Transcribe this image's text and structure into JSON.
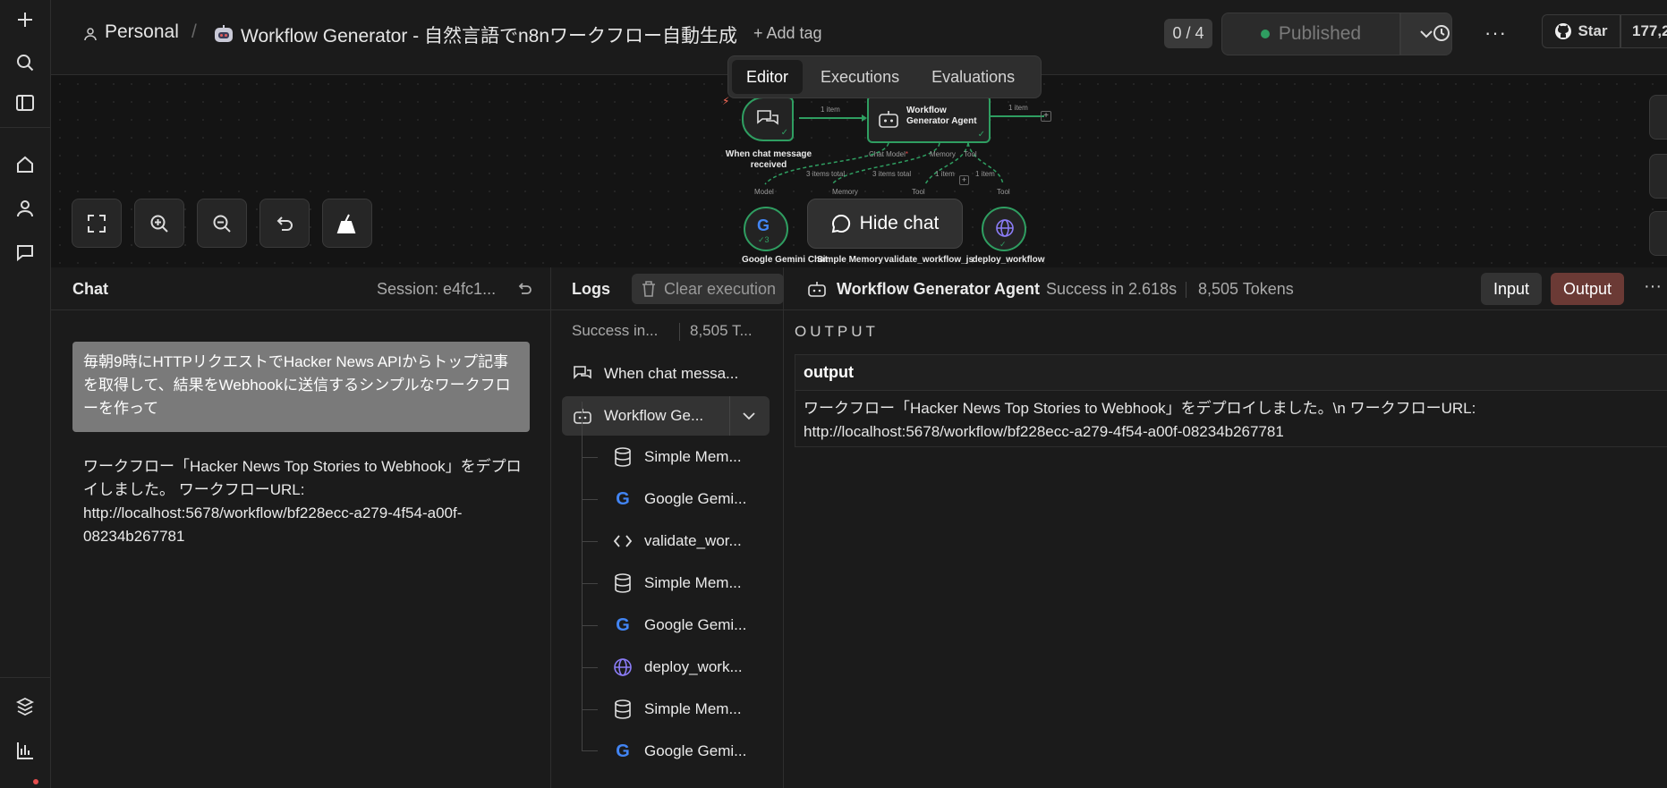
{
  "header": {
    "breadcrumb_project": "Personal",
    "breadcrumb_sep": "/",
    "workflow_title": "Workflow Generator - 自然言語でn8nワークフロー自動生成",
    "add_tag": "+ Add tag",
    "counter": "0 / 4",
    "published": "Published",
    "star": "Star",
    "star_count": "177,2"
  },
  "tabs": [
    {
      "label": "Editor"
    },
    {
      "label": "Executions"
    },
    {
      "label": "Evaluations"
    }
  ],
  "canvas": {
    "trigger_label_1": "When chat message",
    "trigger_label_2": "received",
    "agent_label_1": "Workflow",
    "agent_label_2": "Generator Agent",
    "edge_item_1": "1 item",
    "edge_item_2": "1 item",
    "port_chat_model": "Chat Model",
    "port_memory": "Memory",
    "port_tool": "Tool",
    "items_total_1": "3 items total",
    "items_total_2": "3 items total",
    "tool_item_1": "1 item",
    "tool_item_2": "1 item",
    "sub_model": "Model",
    "sub_memory": "Memory",
    "sub_tool_1": "Tool",
    "sub_tool_2": "Tool",
    "gemini_count": "3",
    "node_gemini": "Google Gemini Chat",
    "node_memory": "Simple Memory",
    "node_validate": "validate_workflow_js",
    "node_deploy": "deploy_workflow",
    "hide_chat": "Hide chat"
  },
  "chat": {
    "title": "Chat",
    "session": "Session: e4fc1...",
    "user_message": "毎朝9時にHTTPリクエストでHacker News APIからトップ記事を取得して、結果をWebhookに送信するシンプルなワークフローを作って",
    "bot_message": "ワークフロー「Hacker News Top Stories to Webhook」をデプロイしました。 ワークフローURL: http://localhost:5678/workflow/bf228ecc-a279-4f54-a00f-08234b267781"
  },
  "logs": {
    "title": "Logs",
    "clear": "Clear execution",
    "summary_status": "Success in...",
    "summary_tokens": "8,505 T...",
    "items": [
      {
        "label": "When chat messa...",
        "icon": "chat-icon"
      },
      {
        "label": "Workflow Ge...",
        "icon": "robot-icon"
      },
      {
        "label": "Simple Mem...",
        "icon": "database-icon"
      },
      {
        "label": "Google Gemi...",
        "icon": "google-icon"
      },
      {
        "label": "validate_wor...",
        "icon": "code-icon"
      },
      {
        "label": "Simple Mem...",
        "icon": "database-icon"
      },
      {
        "label": "Google Gemi...",
        "icon": "google-icon"
      },
      {
        "label": "deploy_work...",
        "icon": "globe-icon"
      },
      {
        "label": "Simple Mem...",
        "icon": "database-icon"
      },
      {
        "label": "Google Gemi...",
        "icon": "google-icon"
      }
    ]
  },
  "output": {
    "node_name": "Workflow Generator Agent",
    "status": "Success in 2.618s",
    "tokens": "8,505 Tokens",
    "input_btn": "Input",
    "output_btn": "Output",
    "section_title": "OUTPUT",
    "column": "output",
    "value_line1": "ワークフロー「Hacker News Top Stories to Webhook」をデプロイしました。\\n ワークフローURL:",
    "value_line2": "http://localhost:5678/workflow/bf228ecc-a279-4f54-a00f-08234b267781"
  },
  "colors": {
    "accent_green": "#2f9e61",
    "output_btn": "#6b3a35",
    "user_bubble": "#7a7a7a"
  }
}
